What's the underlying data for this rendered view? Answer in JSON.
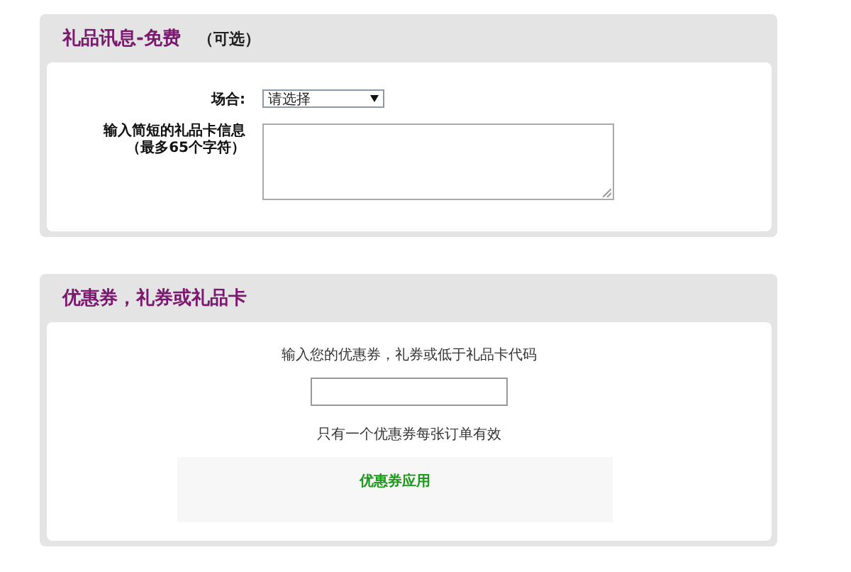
{
  "gift_message": {
    "title": "礼品讯息-免费",
    "optional": "（可选）",
    "occasion": {
      "label": "场合:",
      "value": "请选择"
    },
    "message": {
      "label": "输入简短的礼品卡信息",
      "hint": "（最多65个字符）"
    }
  },
  "coupon": {
    "title": "优惠券，礼券或礼品卡",
    "prompt": "输入您的优惠券，礼券或低于礼品卡代码",
    "note": "只有一个优惠券每张订单有效",
    "apply": "优惠券应用"
  }
}
